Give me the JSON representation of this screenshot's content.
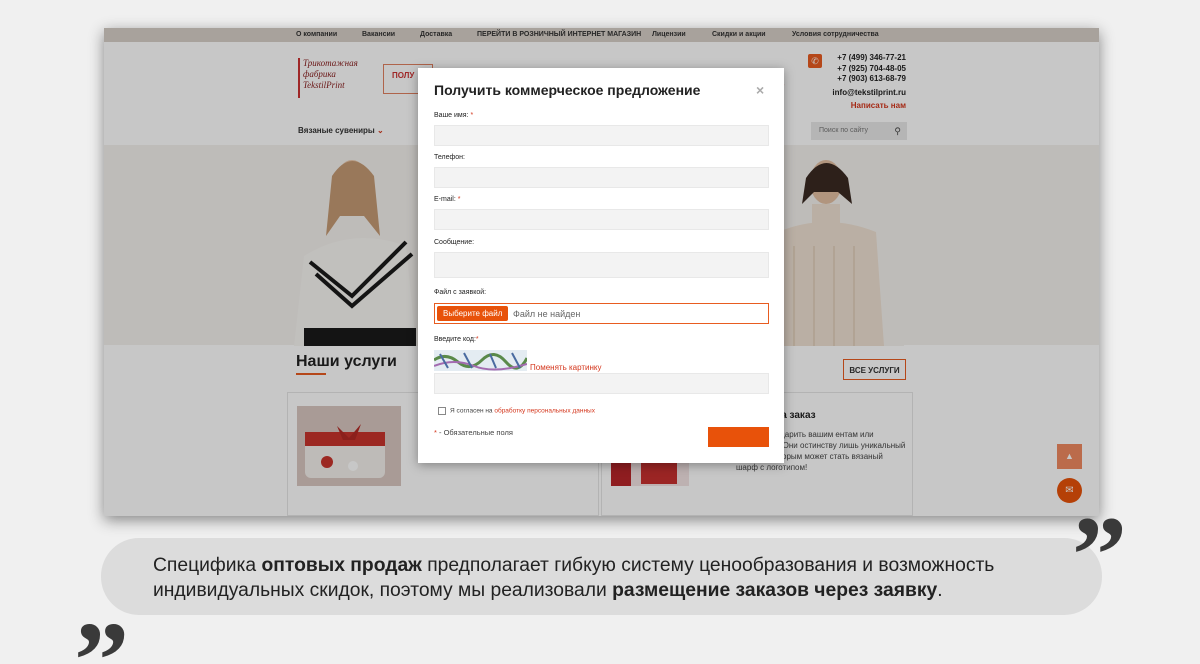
{
  "site": {
    "top_nav": [
      "О компании",
      "Вакансии",
      "Доставка",
      "ПЕРЕЙТИ В РОЗНИЧНЫЙ ИНТЕРНЕТ МАГАЗИН",
      "Лицензии",
      "Скидки и акции",
      "Условия сотрудничества"
    ],
    "logo_lines": [
      "Трикотажная",
      "фабрика",
      "TekstilPrint"
    ],
    "order_button_label": "ПОЛУ",
    "header_fragment": "о",
    "phones": [
      "+7 (499) 346-77-21",
      "+7 (925) 704-48-05",
      "+7 (903) 613-68-79"
    ],
    "email": "info@tekstilprint.ru",
    "write_us": "Написать нам",
    "category_nav": "Вязаные сувениры",
    "search_placeholder": "Поиск по сайту",
    "services_title": "Наши услуги",
    "all_services_button": "ВСЕ УСЛУГИ",
    "card2_title": "язаные на заказ",
    "card2_text": "аете, что подарить вашим ентам или партнерам? Они остинству лишь уникальный подарок, которым может стать вязаный шарф с логотипом!"
  },
  "modal": {
    "title": "Получить коммерческое предложение",
    "close_label": "×",
    "name_label": "Ваше имя:",
    "phone_label": "Телефон:",
    "email_label": "E-mail:",
    "message_label": "Сообщение:",
    "file_label": "Файл с заявкой:",
    "file_button": "Выберите файл",
    "file_status": "Файл не найден",
    "captcha_label": "Введите код:",
    "captcha_link": "Поменять картинку",
    "agree_text": "Я согласен на",
    "agree_link": "обработку персональных данных",
    "required_note": " - Обязательные поля",
    "required_star": "*"
  },
  "quote": {
    "part1": "Специфика ",
    "bold1": "оптовых продаж",
    "part2": " предполагает гибкую систему ценообразования и возможность индивидуальных скидок, поэтому мы реализовали ",
    "bold2": "размещение заказов через заявку",
    "part3": "."
  },
  "colors": {
    "accent": "#e8520a",
    "link": "#d4361c",
    "band": "#dcdcdc"
  }
}
